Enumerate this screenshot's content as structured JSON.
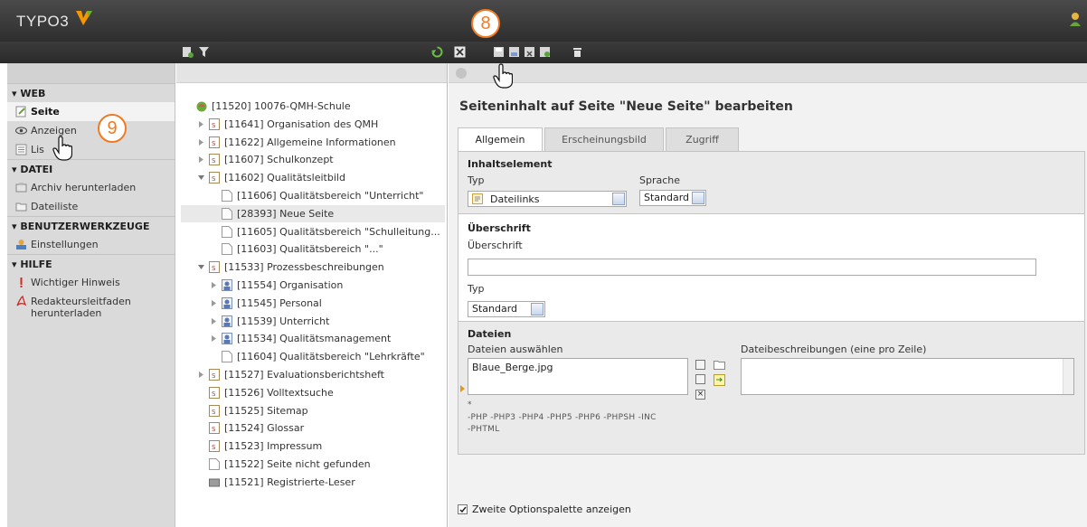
{
  "app": {
    "logo": "TYPO3"
  },
  "colors": {
    "topbar": "#3a3a3a",
    "accent_orange": "#f07a22",
    "selected_row": "#e9e9e9"
  },
  "modules": {
    "sections": [
      {
        "label": "▾ WEB",
        "items": [
          "Seite",
          "Anzeigen",
          "Liste"
        ]
      },
      {
        "label": "▾ DATEI",
        "items": [
          "Archiv herunterladen",
          "Dateiliste"
        ]
      },
      {
        "label": "▾ BENUTZERWERKZEUGE",
        "items": [
          "Einstellungen"
        ]
      },
      {
        "label": "▾ HILFE",
        "items": [
          "Wichtiger Hinweis",
          "Redakteursleitfaden herunterladen"
        ]
      }
    ],
    "visible_list_label": "Lis"
  },
  "tree": {
    "root": "[11520] 10076-QMH-Schule",
    "nodes": [
      "[11641] Organisation des QMH",
      "[11622] Allgemeine Informationen",
      "[11607] Schulkonzept",
      "[11602] Qualitätsleitbild",
      "[11606] Qualitätsbereich \"Unterricht\"",
      "[28393] Neue Seite",
      "[11605] Qualitätsbereich \"Schulleitung...",
      "[11603] Qualitätsbereich \"...\"",
      "[11533] Prozessbeschreibungen",
      "[11554] Organisation",
      "[11545] Personal",
      "[11539] Unterricht",
      "[11534] Qualitätsmanagement",
      "[11604] Qualitätsbereich \"Lehrkräfte\"",
      "[11527] Evaluationsberichtsheft",
      "[11526] Volltextsuche",
      "[11525] Sitemap",
      "[11524] Glossar",
      "[11523] Impressum",
      "[11522] Seite nicht gefunden",
      "[11521] Registrierte-Leser"
    ]
  },
  "content": {
    "title": "Seiteninhalt auf Seite \"Neue Seite\" bearbeiten",
    "tabs": [
      "Allgemein",
      "Erscheinungsbild",
      "Zugriff"
    ],
    "inhaltselement": {
      "header": "Inhaltselement",
      "typ_label": "Typ",
      "typ_value": "Dateilinks",
      "sprache_label": "Sprache",
      "sprache_value": "Standard"
    },
    "ueberschrift": {
      "header": "Überschrift",
      "field_label": "Überschrift",
      "field_value": "",
      "typ_label": "Typ",
      "typ_value": "Standard"
    },
    "dateien": {
      "header": "Dateien",
      "select_label": "Dateien auswählen",
      "files": "Blaue_Berge.jpg",
      "desc_label": "Dateibeschreibungen (eine pro Zeile)",
      "asterisk": "*",
      "excluded_line1": "-PHP -PHP3 -PHP4 -PHP5 -PHP6 -PHPSH -INC",
      "excluded_line2": "-PHTML"
    },
    "option_label": "Zweite Optionspalette anzeigen",
    "option_checked": true
  },
  "callouts": {
    "top": "8",
    "left": "9"
  }
}
